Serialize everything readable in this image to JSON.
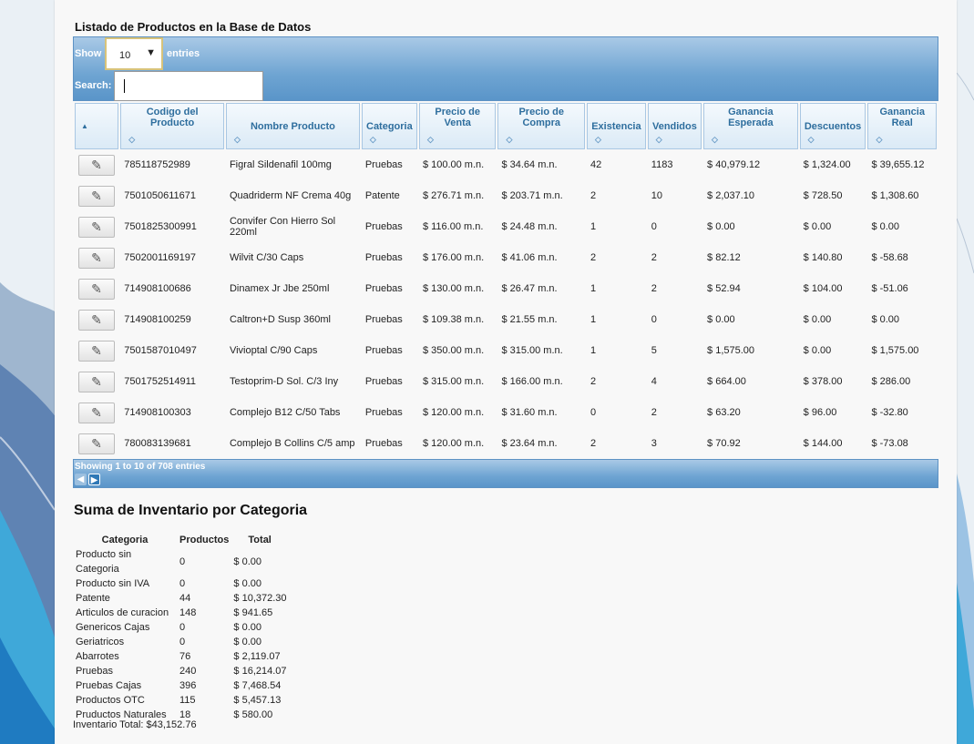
{
  "page_title": "Listado de Productos en la Base de Datos",
  "controls": {
    "show_label": "Show",
    "entries_value": "10",
    "entries_label": "entries",
    "search_label": "Search:",
    "search_value": ""
  },
  "columns": [
    {
      "label": "",
      "sorted": true
    },
    {
      "label": "Codigo del Producto"
    },
    {
      "label": "Nombre Producto"
    },
    {
      "label": "Categoria"
    },
    {
      "label": "Precio de Venta"
    },
    {
      "label": "Precio de Compra"
    },
    {
      "label": "Existencia"
    },
    {
      "label": "Vendidos"
    },
    {
      "label": "Ganancia Esperada"
    },
    {
      "label": "Descuentos"
    },
    {
      "label": "Ganancia Real"
    }
  ],
  "rows": [
    {
      "codigo": "785118752989",
      "nombre": "Figral Sildenafil 100mg",
      "categoria": "Pruebas",
      "venta": "$ 100.00 m.n.",
      "compra": "$ 34.64 m.n.",
      "existencia": "42",
      "vendidos": "1183",
      "esperada": "$ 40,979.12",
      "descuentos": "$ 1,324.00",
      "real": "$ 39,655.12"
    },
    {
      "codigo": "7501050611671",
      "nombre": "Quadriderm NF Crema 40g",
      "categoria": "Patente",
      "venta": "$ 276.71 m.n.",
      "compra": "$ 203.71 m.n.",
      "existencia": "2",
      "vendidos": "10",
      "esperada": "$ 2,037.10",
      "descuentos": "$ 728.50",
      "real": "$ 1,308.60"
    },
    {
      "codigo": "7501825300991",
      "nombre": "Convifer Con Hierro Sol 220ml",
      "categoria": "Pruebas",
      "venta": "$ 116.00 m.n.",
      "compra": "$ 24.48 m.n.",
      "existencia": "1",
      "vendidos": "0",
      "esperada": "$ 0.00",
      "descuentos": "$ 0.00",
      "real": "$ 0.00"
    },
    {
      "codigo": "7502001169197",
      "nombre": "Wilvit C/30 Caps",
      "categoria": "Pruebas",
      "venta": "$ 176.00 m.n.",
      "compra": "$ 41.06 m.n.",
      "existencia": "2",
      "vendidos": "2",
      "esperada": "$ 82.12",
      "descuentos": "$ 140.80",
      "real": "$ -58.68"
    },
    {
      "codigo": "714908100686",
      "nombre": "Dinamex Jr Jbe 250ml",
      "categoria": "Pruebas",
      "venta": "$ 130.00 m.n.",
      "compra": "$ 26.47 m.n.",
      "existencia": "1",
      "vendidos": "2",
      "esperada": "$ 52.94",
      "descuentos": "$ 104.00",
      "real": "$ -51.06"
    },
    {
      "codigo": "714908100259",
      "nombre": "Caltron+D Susp 360ml",
      "categoria": "Pruebas",
      "venta": "$ 109.38 m.n.",
      "compra": "$ 21.55 m.n.",
      "existencia": "1",
      "vendidos": "0",
      "esperada": "$ 0.00",
      "descuentos": "$ 0.00",
      "real": "$ 0.00"
    },
    {
      "codigo": "7501587010497",
      "nombre": "Vivioptal C/90 Caps",
      "categoria": "Pruebas",
      "venta": "$ 350.00 m.n.",
      "compra": "$ 315.00 m.n.",
      "existencia": "1",
      "vendidos": "5",
      "esperada": "$ 1,575.00",
      "descuentos": "$ 0.00",
      "real": "$ 1,575.00"
    },
    {
      "codigo": "7501752514911",
      "nombre": "Testoprim-D Sol. C/3 Iny",
      "categoria": "Pruebas",
      "venta": "$ 315.00 m.n.",
      "compra": "$ 166.00 m.n.",
      "existencia": "2",
      "vendidos": "4",
      "esperada": "$ 664.00",
      "descuentos": "$ 378.00",
      "real": "$ 286.00"
    },
    {
      "codigo": "714908100303",
      "nombre": "Complejo B12 C/50 Tabs",
      "categoria": "Pruebas",
      "venta": "$ 120.00 m.n.",
      "compra": "$ 31.60 m.n.",
      "existencia": "0",
      "vendidos": "2",
      "esperada": "$ 63.20",
      "descuentos": "$ 96.00",
      "real": "$ -32.80"
    },
    {
      "codigo": "780083139681",
      "nombre": "Complejo B Collins C/5 amp",
      "categoria": "Pruebas",
      "venta": "$ 120.00 m.n.",
      "compra": "$ 23.64 m.n.",
      "existencia": "2",
      "vendidos": "3",
      "esperada": "$ 70.92",
      "descuentos": "$ 144.00",
      "real": "$ -73.08"
    }
  ],
  "pagination": {
    "info": "Showing 1 to 10 of 708 entries",
    "prev_icon": "arrow-left-icon",
    "next_icon": "arrow-right-icon"
  },
  "summary": {
    "title": "Suma de Inventario por Categoria",
    "headers": [
      "Categoria",
      "Productos",
      "Total"
    ],
    "rows": [
      {
        "categoria": "Producto sin Categoria",
        "productos": "0",
        "total": "$ 0.00"
      },
      {
        "categoria": "Producto sin IVA",
        "productos": "0",
        "total": "$ 0.00"
      },
      {
        "categoria": "Patente",
        "productos": "44",
        "total": "$ 10,372.30"
      },
      {
        "categoria": "Articulos de curacion",
        "productos": "148",
        "total": "$ 941.65"
      },
      {
        "categoria": "Genericos Cajas",
        "productos": "0",
        "total": "$ 0.00"
      },
      {
        "categoria": "Geriatricos",
        "productos": "0",
        "total": "$ 0.00"
      },
      {
        "categoria": "Abarrotes",
        "productos": "76",
        "total": "$ 2,119.07"
      },
      {
        "categoria": "Pruebas",
        "productos": "240",
        "total": "$ 16,214.07"
      },
      {
        "categoria": "Pruebas Cajas",
        "productos": "396",
        "total": "$ 7,468.54"
      },
      {
        "categoria": "Productos OTC",
        "productos": "115",
        "total": "$ 5,457.13"
      },
      {
        "categoria": "Pruductos Naturales",
        "productos": "18",
        "total": "$ 580.00"
      }
    ],
    "total_line": "Inventario Total: $43,152.76"
  },
  "colors": {
    "toolbar": "#6ea4d2",
    "header_text": "#2e6e9e"
  }
}
